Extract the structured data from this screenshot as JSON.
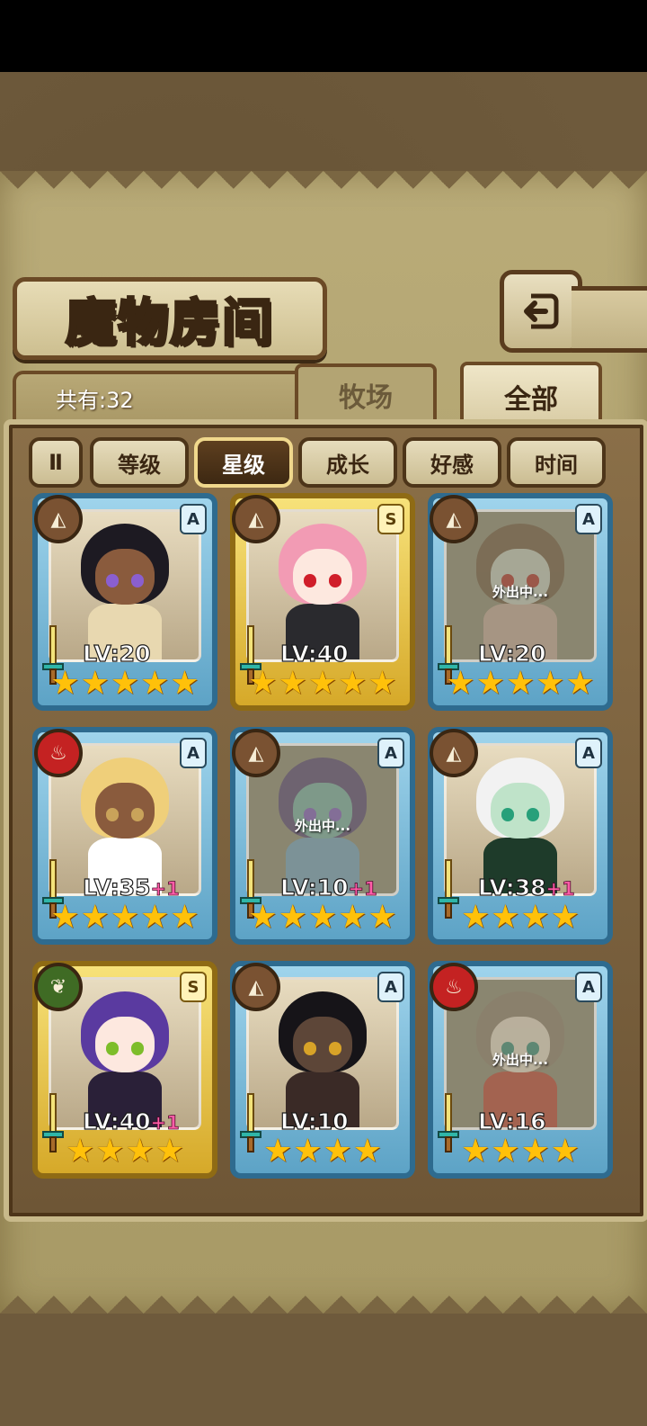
{
  "title": "魔物房间",
  "back_icon": "back-arrow-icon",
  "count_text": "共有:32",
  "tabs": [
    {
      "label": "牧场",
      "active": false
    },
    {
      "label": "全部",
      "active": true
    }
  ],
  "sort": {
    "toggle_label": "Ⅱ",
    "buttons": [
      {
        "label": "等级",
        "active": false
      },
      {
        "label": "星级",
        "active": true
      },
      {
        "label": "成长",
        "active": false
      },
      {
        "label": "好感",
        "active": false
      },
      {
        "label": "时间",
        "active": false
      }
    ]
  },
  "away_label": "外出中...",
  "cards": [
    {
      "rank": "A",
      "element": "earth",
      "level": "LV:20",
      "plus": "",
      "stars": 5,
      "away": false,
      "hair": "#1d1a22",
      "skin": "#8a5b3d",
      "eye": "#8a5fd0",
      "outfit": "#e8d8b0"
    },
    {
      "rank": "S",
      "element": "earth",
      "level": "LV:40",
      "plus": "",
      "stars": 5,
      "away": false,
      "hair": "#f29bb4",
      "skin": "#fde8df",
      "eye": "#d01e2a",
      "outfit": "#2a2a2e"
    },
    {
      "rank": "A",
      "element": "earth",
      "level": "LV:20",
      "plus": "",
      "stars": 5,
      "away": true,
      "hair": "#6b5038",
      "skin": "#c8d0c4",
      "eye": "#b0201c",
      "outfit": "#c8a89a"
    },
    {
      "rank": "A",
      "element": "fire",
      "level": "LV:35",
      "plus": "+1",
      "stars": 5,
      "away": false,
      "hair": "#efcf7a",
      "skin": "#8a5b3d",
      "eye": "#c9a35a",
      "outfit": "#ffffff"
    },
    {
      "rank": "A",
      "element": "earth",
      "level": "LV:10",
      "plus": "+1",
      "stars": 5,
      "away": true,
      "hair": "#4c3a72",
      "skin": "#6fb1a8",
      "eye": "#7a52c8",
      "outfit": "#6aa3c8"
    },
    {
      "rank": "A",
      "element": "earth",
      "level": "LV:38",
      "plus": "+1",
      "stars": 4,
      "away": false,
      "hair": "#f2f2f2",
      "skin": "#bfe3c9",
      "eye": "#27a07a",
      "outfit": "#1e3b2a"
    },
    {
      "rank": "S",
      "element": "wood",
      "level": "LV:40",
      "plus": "+1",
      "stars": 4,
      "away": false,
      "hair": "#5a3aa0",
      "skin": "#fde8df",
      "eye": "#7dbd2a",
      "outfit": "#2a2038"
    },
    {
      "rank": "A",
      "element": "earth",
      "level": "LV:10",
      "plus": "",
      "stars": 4,
      "away": false,
      "hair": "#161418",
      "skin": "#5d4638",
      "eye": "#d8a328",
      "outfit": "#3a2a26"
    },
    {
      "rank": "A",
      "element": "fire",
      "level": "LV:16",
      "plus": "",
      "stars": 4,
      "away": true,
      "hair": "#8a7a68",
      "skin": "#f1e3d2",
      "eye": "#2a8a78",
      "outfit": "#c23a2a"
    }
  ],
  "colors": {
    "rank_A_frame": "#5da3c6",
    "rank_S_frame": "#d6a929",
    "star": "#ffc10a",
    "plus_level": "#ff5da8"
  }
}
